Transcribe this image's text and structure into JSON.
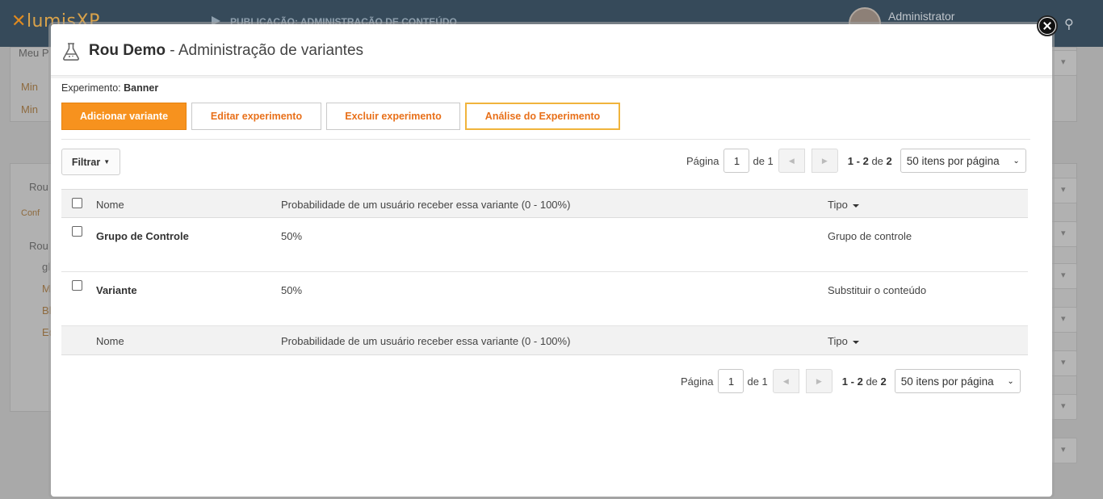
{
  "background": {
    "logo_mark": "✕",
    "logo_text": "lumisXP",
    "breadcrumb": "PUBLICAÇÃO: ADMINISTRAÇÃO DE CONTEÚDO",
    "user_name": "Administrator",
    "left_items": [
      "Meu P",
      "Min",
      "Min",
      "Rou",
      "Conf",
      "Rou",
      "gl",
      "M",
      "Bl",
      "Ed"
    ]
  },
  "modal": {
    "title_strong": "Rou Demo",
    "title_rest": " - Administração de variantes",
    "experiment_label": "Experimento:",
    "experiment_value": "Banner",
    "toolbar": {
      "add_label": "Adicionar variante",
      "edit_label": "Editar experimento",
      "delete_label": "Excluir experimento",
      "analysis_label": "Análise do Experimento"
    },
    "filter_label": "Filtrar",
    "pager": {
      "page_label": "Página",
      "page_value": "1",
      "of_label": "de 1",
      "range_bold": "1 - 2",
      "range_of": "de",
      "range_total": "2",
      "per_page": "50 itens por página"
    },
    "columns": {
      "name": "Nome",
      "probability": "Probabilidade de um usuário receber essa variante (0 - 100%)",
      "type": "Tipo"
    },
    "rows": [
      {
        "name": "Grupo de Controle",
        "probability": "50%",
        "type": "Grupo de controle"
      },
      {
        "name": "Variante",
        "probability": "50%",
        "type": "Substituir o conteúdo"
      }
    ]
  },
  "colors": {
    "accent": "#f7921e",
    "accent_text": "#e8701a",
    "topbar": "#364a5a"
  },
  "icons": {
    "header": "flask-icon",
    "close": "close-icon"
  }
}
